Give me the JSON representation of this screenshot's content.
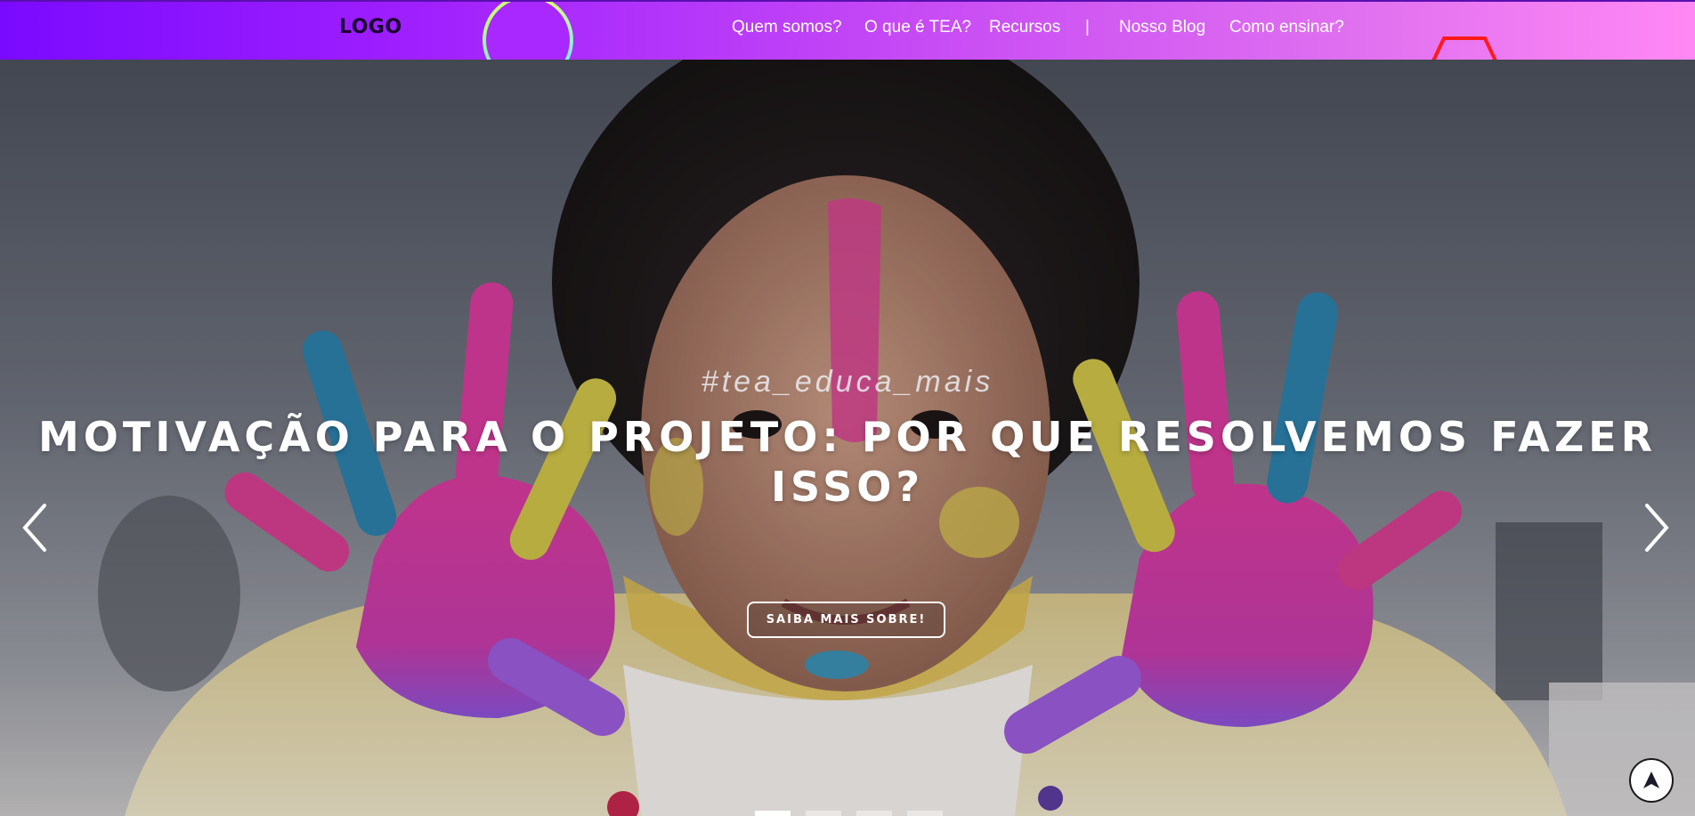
{
  "header": {
    "logo_text": "LOGO",
    "nav": {
      "quem_somos": "Quem somos?",
      "o_que_e_tea": "O que é TEA?",
      "recursos": "Recursos",
      "separator": "|",
      "nosso_blog": "Nosso Blog",
      "como_ensinar": "Como ensinar?"
    },
    "gradient_start": "#7a0aff",
    "gradient_end": "#ff88f4"
  },
  "hero": {
    "hashtag": "#tea_educa_mais",
    "headline": "MOTIVAÇÃO PARA O PROJETO: POR QUE RESOLVEMOS FAZER ISSO?",
    "cta_label": "SAIBA MAIS SOBRE!",
    "prev_icon": "chevron-left-icon",
    "next_icon": "chevron-right-icon",
    "slide_count": 4,
    "active_slide": 1
  },
  "scroll_top_icon": "arrow-up-icon",
  "colors": {
    "accent_purple": "#a020ff",
    "accent_pink": "#e0409a",
    "hex_red": "#ff1a1a"
  }
}
